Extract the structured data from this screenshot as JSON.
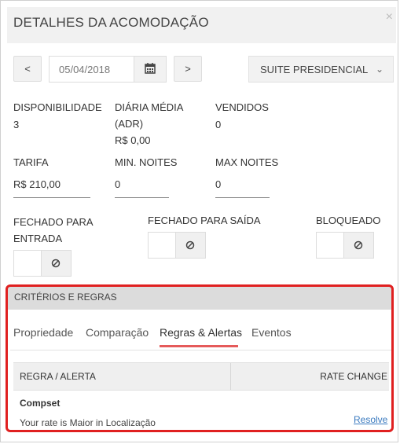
{
  "header": {
    "title": "DETALHES DA ACOMODAÇÃO",
    "close": "×"
  },
  "nav": {
    "prev": "<",
    "date": "05/04/2018",
    "next": ">",
    "room_type": "SUITE PRESIDENCIAL"
  },
  "stats": {
    "availability_label": "DISPONIBILIDADE",
    "availability_value": "3",
    "adr_label_1": "DIÁRIA MÉDIA",
    "adr_label_2": "(ADR)",
    "adr_value": "R$ 0,00",
    "sold_label": "VENDIDOS",
    "sold_value": "0"
  },
  "fields": {
    "rate_label": "TARIFA",
    "rate_value": "R$ 210,00",
    "min_label": "MIN. NOITES",
    "min_value": "0",
    "max_label": "MAX NOITES",
    "max_value": "0"
  },
  "toggles": {
    "closed_arrival_1": "FECHADO PARA",
    "closed_arrival_2": "ENTRADA",
    "closed_departure": "FECHADO PARA SAÍDA",
    "blocked": "BLOQUEADO"
  },
  "section": {
    "title": "CRITÉRIOS E REGRAS",
    "tabs": [
      {
        "label": "Propriedade"
      },
      {
        "label": "Comparação"
      },
      {
        "label": "Regras & Alertas"
      },
      {
        "label": "Eventos"
      }
    ],
    "table": {
      "col1": "REGRA / ALERTA",
      "col2": "RATE CHANGE",
      "row": {
        "title": "Compset",
        "desc": "Your rate is Maior in Localização",
        "action": "Resolve"
      }
    }
  }
}
